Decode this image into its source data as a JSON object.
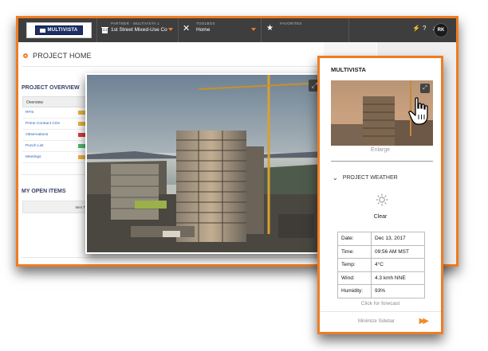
{
  "topbar": {
    "logo_text": "MULTIVISTA",
    "partner_label": "PARTNER · MULTIVISTA 1",
    "project_name": "1st Street Mixed-Use Co",
    "toolbox_label": "TOOLBOX",
    "toolbox_value": "Home",
    "favorites_label": "FAVORITES",
    "avatar_initials": "RK"
  },
  "main": {
    "page_title": "PROJECT HOME",
    "overview_title": "PROJECT OVERVIEW",
    "overview_header": "Overview",
    "overview_rows": [
      {
        "label": "RFIs",
        "color": "#e8b23a"
      },
      {
        "label": "Prime Contract COs",
        "color": "#e8b23a"
      },
      {
        "label": "Observations",
        "color": "#d9383a"
      },
      {
        "label": "Punch List",
        "color": "#4cb86a"
      },
      {
        "label": "Meetings",
        "color": "#e8b23a"
      }
    ],
    "open_items_title": "MY OPEN ITEMS",
    "items_header": "Item Ty"
  },
  "sidebar": {
    "title": "MULTIVISTA",
    "enlarge_label": "Enlarge",
    "weather_title": "PROJECT WEATHER",
    "condition": "Clear",
    "weather_rows": [
      {
        "key": "Date:",
        "value": "Dec 13, 2017"
      },
      {
        "key": "Time:",
        "value": "09:56 AM MST"
      },
      {
        "key": "Temp:",
        "value": "4°C"
      },
      {
        "key": "Wind:",
        "value": "4.3 kmh NNE"
      },
      {
        "key": "Humidity:",
        "value": "93%"
      }
    ],
    "forecast_link": "Click for forecast",
    "minimize_label": "Minimize Sidebar"
  },
  "colors": {
    "accent": "#ef7d22",
    "topbar": "#3e3e3e"
  }
}
